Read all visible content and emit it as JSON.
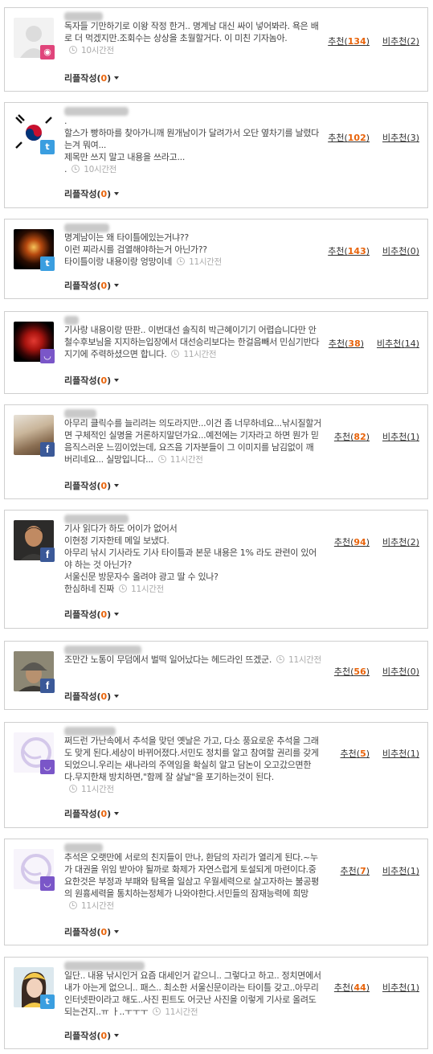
{
  "labels": {
    "reply": "리플작성",
    "up": "추천",
    "down": "비추천"
  },
  "colors": {
    "accent": "#e8630a",
    "text": "#444444",
    "border": "#cfcfcf"
  },
  "comments": [
    {
      "text": "독자들 기만하기로 이왕 작정 한거.. 명계남 대신 싸이 넣어봐라. 욕은 배로 더 먹겠지만.조회수는 상상을 초월할거다. 이 미친 기자놈아.",
      "time": "10시간전",
      "reply_count": "0",
      "up": "134",
      "down": "2",
      "service": "nate-icon",
      "avatar": "default-avatar"
    },
    {
      "text": ".\n할스가 빵하마를 찾아가니깨 뭔개남이가 달려가서 오단 옆차기를 날렸다는겨 뭐여...\n제목만 쓰지 말고 내용을 쓰라고...\n.",
      "time": "10시간전",
      "reply_count": "0",
      "up": "102",
      "down": "3",
      "service": "twitter-icon",
      "avatar": "korean-flag-avatar"
    },
    {
      "text": "명계남이는 왜 타이틀에있는거냐??\n이런 찌라시를 검열해야하는거 아닌가??\n타이틀이랑 내용이랑 엉망이네",
      "time": "11시간전",
      "reply_count": "0",
      "up": "143",
      "down": "0",
      "service": "twitter-icon",
      "avatar": "fire-avatar"
    },
    {
      "text": "기사랑 내용이랑 딴판.. 이번대선 솔직히 박근혜이기기 어렵습니다만 안철수후보님을 지지하는입장에서 대선승리보다는 한걸음빼서 민심기반다지기에 주력하셨으면 합니다.",
      "time": "11시간전",
      "reply_count": "0",
      "up": "38",
      "down": "14",
      "service": "kakao-icon",
      "avatar": "rose-avatar"
    },
    {
      "text": "아무리 클릭수를 늘리려는 의도라지만...이건 좀 너무하네요...낚시질할거면 구체적인 실명을 거론하지말던가요...예전에는 기자라고 하면 뭔가 믿음직스러운 느낌이었는데, 요즈음 기자분들이 그 이미지를 남김없이 깨버리네요... 실망입니다...",
      "time": "11시간전",
      "reply_count": "0",
      "up": "82",
      "down": "1",
      "service": "facebook-icon",
      "avatar": "photo-avatar"
    },
    {
      "text": "기사 읽다가 하도 어이가 없어서\n이현정 기자한테 메일 보냈다.\n아무리 낚시 기사라도 기사 타이틀과 본문 내용은 1% 라도 관련이 있어야 하는 것 아닌가?\n서울신문 방문자수 올려야 광고 딸 수 있나?\n한심하네 진짜",
      "time": "11시간전",
      "reply_count": "0",
      "up": "94",
      "down": "2",
      "service": "facebook-icon",
      "avatar": "man-avatar"
    },
    {
      "text": "조만간 노통이 무덤에서 벌떡 일어났다는 헤드라인 뜨겠군.",
      "time": "11시간전",
      "reply_count": "0",
      "up": "56",
      "down": "0",
      "service": "facebook-icon",
      "avatar": "cap-man-avatar"
    },
    {
      "text": "쩌드런 가난속에서 추석을 맞던 옛날은 가고, 다소 풍요로운 추석을 그래도 맞게 된다.세상이 바뀌어졌다.서민도 정치를 알고 참여할 권리를 갖게 되었으니.우리는 새나라의 주역임을 확실히 알고 담논이 오고갔으면한다.무지한채 방치하면,\"함께 잘 살날\"을 포기하는것이 된다.",
      "time": "11시간전",
      "reply_count": "0",
      "up": "5",
      "down": "1",
      "service": "kakao-icon",
      "avatar": "default-ring-avatar"
    },
    {
      "text": "추석은 오랫만에 서로의 친지들이 만나, 환담의 자리가 열리게 된다.~누가 대권을 위임 받아야 될까로 화제가 자연스럽게 토설되게 마련이다.중요한것은 부정과 부패와 탐욕을 일삼고 우월세력으로 살고자하는 불공평의 원흉세력을 통치하는정체가 나와야한다.서민들의 잠재능력에 희망",
      "time": "11시간전",
      "reply_count": "0",
      "up": "7",
      "down": "1",
      "service": "kakao-icon",
      "avatar": "default-ring-avatar"
    },
    {
      "text": "일단.. 내용 낚시인거 요즘 대세인거 같으니.. 그렇다고 하고.. 정치면에서 내가 아는게 없으니.. 패스.. 최소한 서울신문이라는 타이틀 갖고..아무리 인터넷판이라고 해도..사진 핀트도 어긋난 사진을 이렇게 기사로 올려도 되는건지..ㅠ ㅏ..ㅜㅜㅜ",
      "time": "11시간전",
      "reply_count": "0",
      "up": "44",
      "down": "1",
      "service": "twitter-icon",
      "avatar": "girl-avatar"
    }
  ]
}
